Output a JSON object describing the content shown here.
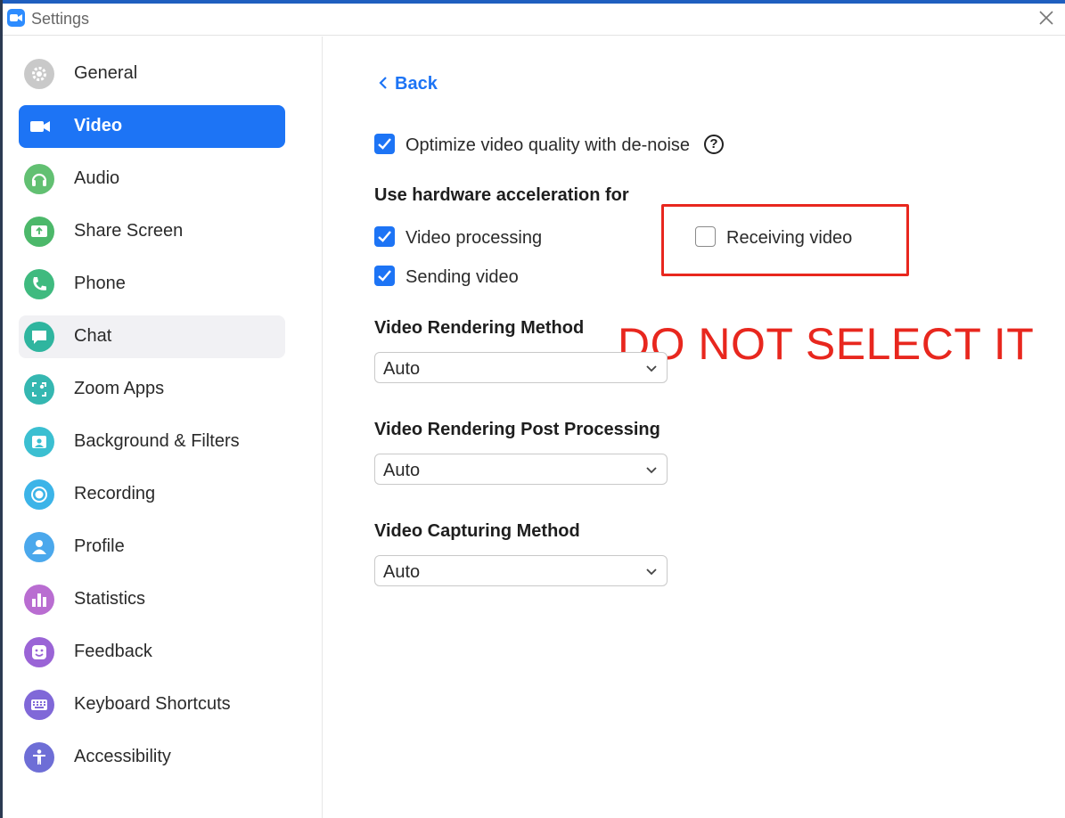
{
  "window": {
    "title": "Settings"
  },
  "sidebar": {
    "items": [
      {
        "label": "General",
        "icon": "gear-icon",
        "color": "#b8b8b8"
      },
      {
        "label": "Video",
        "icon": "video-camera-icon",
        "color": "#1d74f5",
        "selected": true
      },
      {
        "label": "Audio",
        "icon": "headphones-icon",
        "color": "#5fbf6a"
      },
      {
        "label": "Share Screen",
        "icon": "share-screen-icon",
        "color": "#4cb86a"
      },
      {
        "label": "Phone",
        "icon": "phone-icon",
        "color": "#3fba7f"
      },
      {
        "label": "Chat",
        "icon": "chat-bubble-icon",
        "color": "#2fb59f"
      },
      {
        "label": "Zoom Apps",
        "icon": "apps-icon",
        "color": "#35b7b1"
      },
      {
        "label": "Background & Filters",
        "icon": "background-icon",
        "color": "#3bbfd1"
      },
      {
        "label": "Recording",
        "icon": "record-icon",
        "color": "#3cb4e8"
      },
      {
        "label": "Profile",
        "icon": "profile-icon",
        "color": "#4ba8ec"
      },
      {
        "label": "Statistics",
        "icon": "statistics-icon",
        "color": "#b96dd1"
      },
      {
        "label": "Feedback",
        "icon": "feedback-icon",
        "color": "#9a64d6"
      },
      {
        "label": "Keyboard Shortcuts",
        "icon": "keyboard-icon",
        "color": "#8068d8"
      },
      {
        "label": "Accessibility",
        "icon": "accessibility-icon",
        "color": "#6e6ed6"
      }
    ]
  },
  "main": {
    "back_label": "Back",
    "denoise": {
      "label": "Optimize video quality with de-noise",
      "checked": true
    },
    "hw_accel": {
      "heading": "Use hardware acceleration for",
      "video_processing": {
        "label": "Video processing",
        "checked": true
      },
      "sending_video": {
        "label": "Sending video",
        "checked": true
      },
      "receiving_video": {
        "label": "Receiving video",
        "checked": false
      }
    },
    "rendering_method": {
      "heading": "Video Rendering Method",
      "value": "Auto"
    },
    "post_processing": {
      "heading": "Video Rendering Post Processing",
      "value": "Auto"
    },
    "capturing_method": {
      "heading": "Video Capturing Method",
      "value": "Auto"
    }
  },
  "annotation": {
    "text": "DO NOT SELECT IT",
    "color": "#e8271e"
  },
  "colors": {
    "accent": "#1d74f5"
  }
}
